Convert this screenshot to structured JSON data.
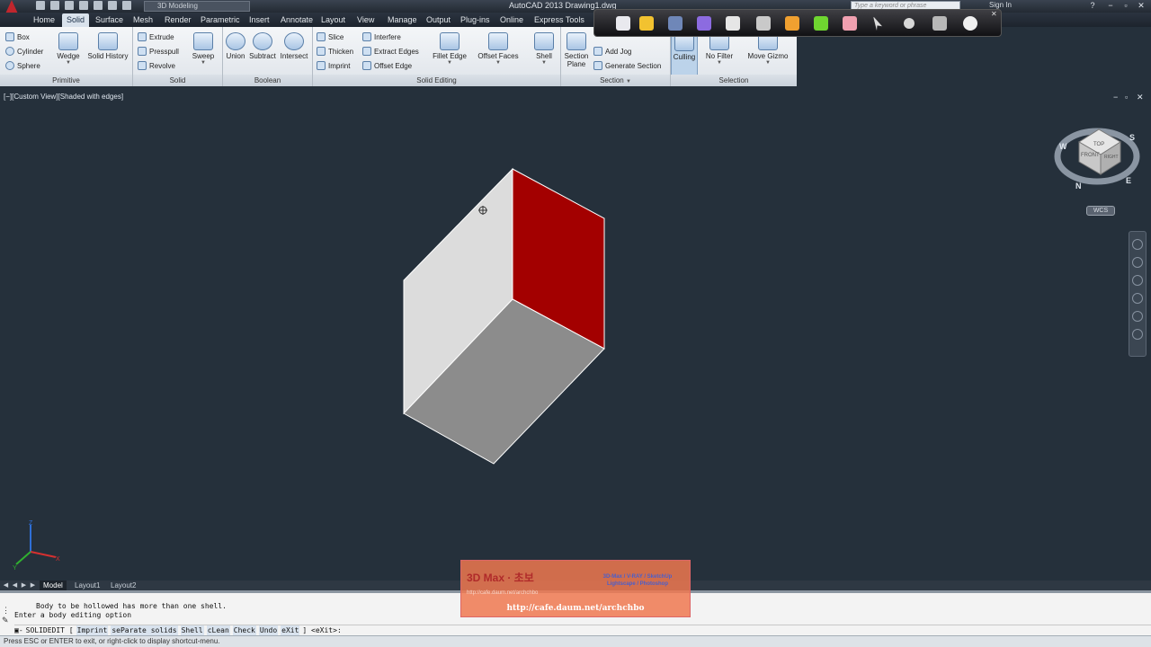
{
  "title_bar": {
    "app_title": "AutoCAD 2013    Drawing1.dwg",
    "workspace": "3D Modeling",
    "search_placeholder": "Type a keyword or phrase",
    "sign_in": "Sign In"
  },
  "ribbon_tabs": [
    "Home",
    "Solid",
    "Surface",
    "Mesh",
    "Render",
    "Parametric",
    "Insert",
    "Annotate",
    "Layout",
    "View",
    "Manage",
    "Output",
    "Plug-ins",
    "Online",
    "Express Tools"
  ],
  "active_tab": "Solid",
  "ribbon": {
    "primitive": {
      "title": "Primitive",
      "box": "Box",
      "cylinder": "Cylinder",
      "sphere": "Sphere",
      "wedge": "Wedge",
      "solid_history": "Solid History"
    },
    "solid": {
      "title": "Solid",
      "extrude": "Extrude",
      "presspull": "Presspull",
      "revolve": "Revolve",
      "sweep": "Sweep"
    },
    "boolean": {
      "title": "Boolean",
      "union": "Union",
      "subtract": "Subtract",
      "intersect": "Intersect"
    },
    "solid_editing": {
      "title": "Solid Editing",
      "slice": "Slice",
      "thicken": "Thicken",
      "imprint": "Imprint",
      "interfere": "Interfere",
      "extract_edges": "Extract Edges",
      "offset_edge": "Offset Edge",
      "fillet_edge": "Fillet Edge",
      "offset_faces": "Offset Faces",
      "shell": "Shell"
    },
    "section": {
      "title": "Section",
      "section_plane": "Section Plane",
      "add_jog": "Add Jog",
      "generate_section": "Generate Section"
    },
    "selection": {
      "title": "Selection",
      "culling": "Culling",
      "no_filter": "No Filter",
      "move_gizmo": "Move Gizmo"
    }
  },
  "viewport": {
    "label": "[−][Custom View][Shaded with edges]",
    "wcs": "WCS",
    "compass": {
      "n": "N",
      "e": "E",
      "s": "S",
      "w": "W"
    },
    "viewcube_faces": {
      "top": "TOP",
      "front": "FRONT",
      "right": "RIGHT"
    },
    "ucs": {
      "x": "X",
      "y": "Y",
      "z": "Z"
    }
  },
  "layout_tabs": [
    "Model",
    "Layout1",
    "Layout2"
  ],
  "active_layout": "Model",
  "command": {
    "history_1": "Body to be hollowed has more than one shell.",
    "history_2": "Enter a body editing option",
    "prompt": "SOLIDEDIT [",
    "options": [
      "Imprint",
      "seParate solids",
      "Shell",
      "cLean",
      "Check",
      "Undo",
      "eXit"
    ],
    "suffix": "] <eXit>:"
  },
  "status_bar": "Press ESC or ENTER to exit, or right-click to display shortcut-menu.",
  "watermark": {
    "logo": "3D  Max  ·  초보",
    "tags_1": "3D-Max / V-RAY / SketchUp",
    "tags_2": "Lightscape / Photoshop",
    "url_small": "http://cafe.daum.net/archchbo",
    "url": "http://cafe.daum.net/archchbo"
  },
  "colors": {
    "viewport_bg": "#25303b",
    "face_red": "#a30000",
    "face_light": "#dcdcdc",
    "face_dark": "#8c8c8c"
  }
}
